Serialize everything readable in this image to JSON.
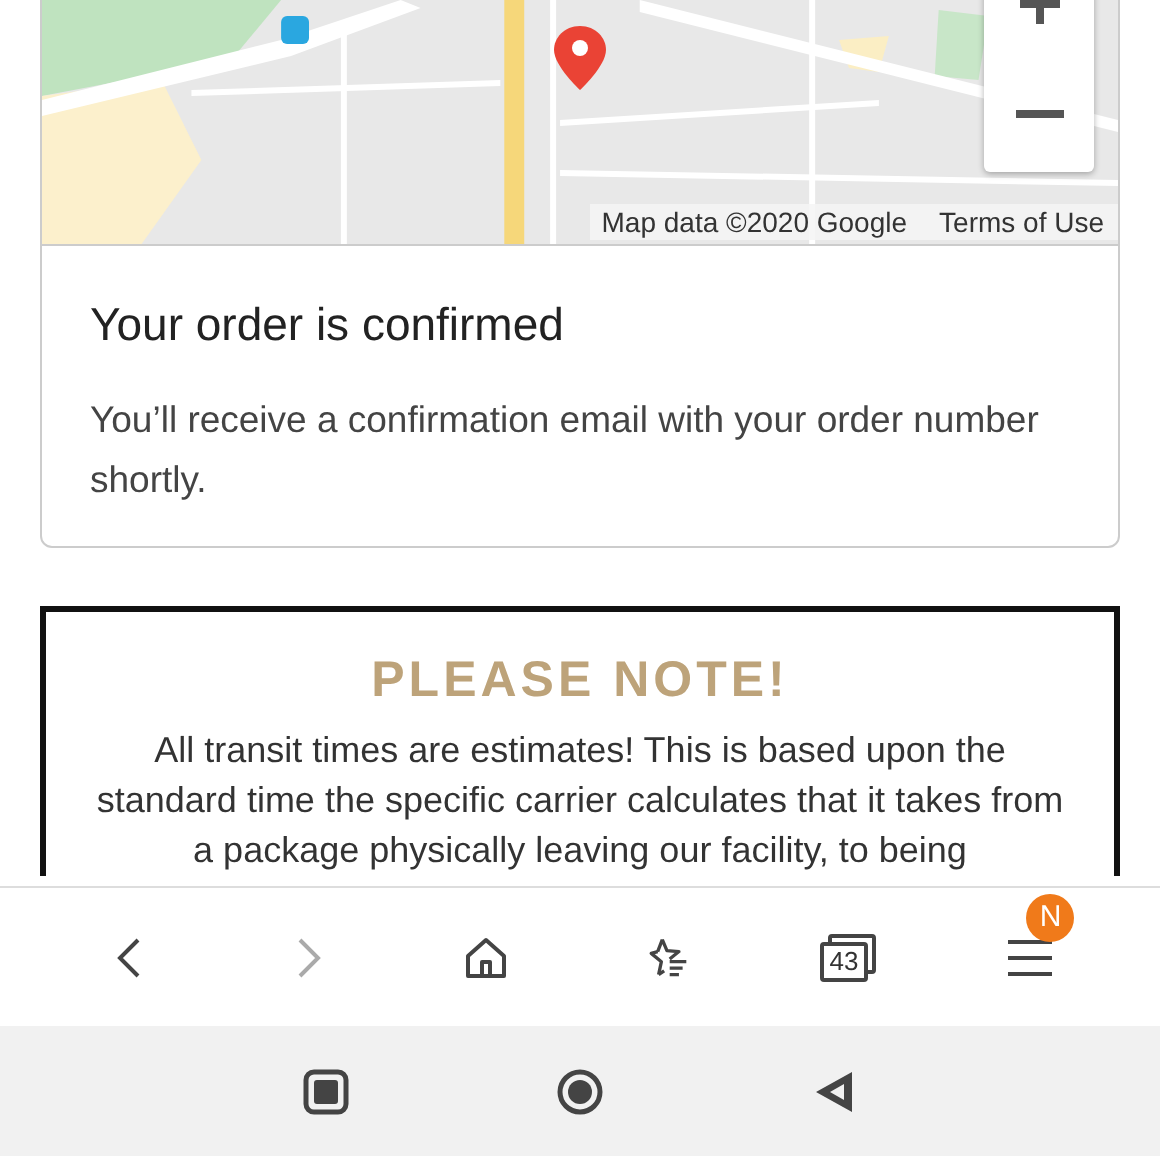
{
  "map": {
    "attribution": "Map data ©2020 Google",
    "terms_link": "Terms of Use"
  },
  "confirmation": {
    "title": "Your order is confirmed",
    "message": "You’ll receive a confirmation email with your order number shortly."
  },
  "note": {
    "title": "PLEASE NOTE!",
    "text": "All transit times are estimates! This is based upon the standard time the specific carrier calculates that it takes from a package physically leaving our facility, to being"
  },
  "browser_toolbar": {
    "forward_disabled": true,
    "tab_count": "43",
    "menu_badge": "N"
  }
}
